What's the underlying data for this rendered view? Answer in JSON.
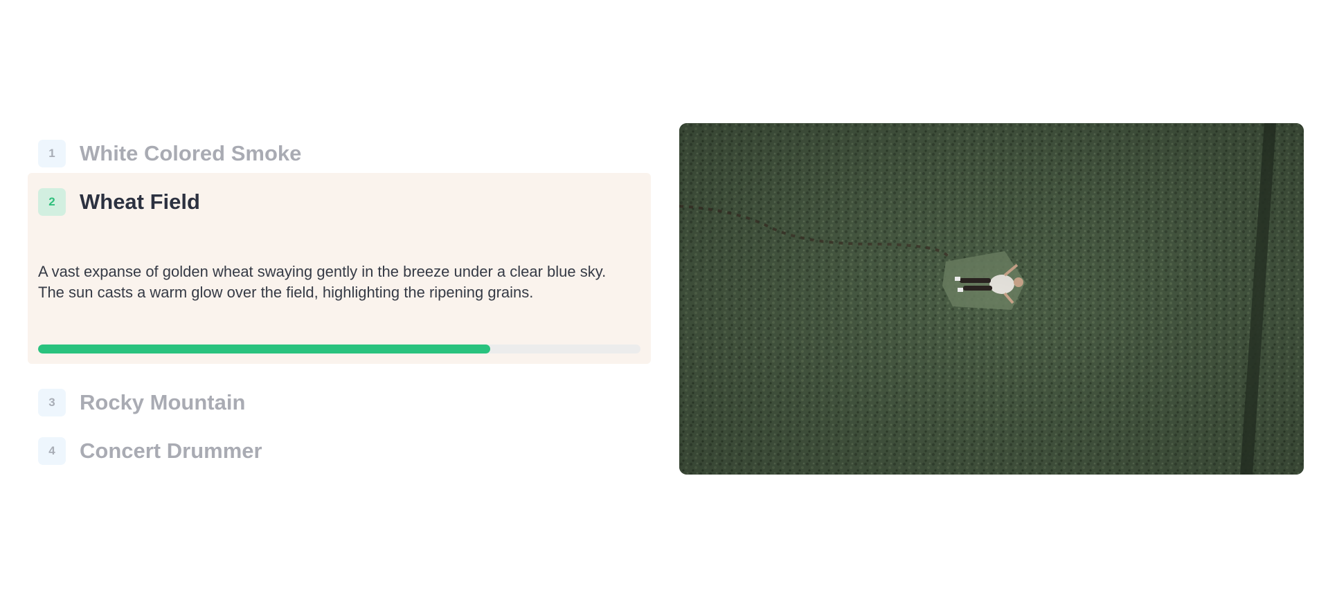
{
  "accordion": {
    "items": [
      {
        "number": "1",
        "title": "White Colored Smoke"
      },
      {
        "number": "2",
        "title": "Wheat Field",
        "description": "A vast expanse of golden wheat swaying gently in the breeze under a clear blue sky. The sun casts a warm glow over the field, highlighting the ripening grains.",
        "progress": 0.75
      },
      {
        "number": "3",
        "title": "Rocky Mountain"
      },
      {
        "number": "4",
        "title": "Concert Drummer"
      }
    ],
    "active_index": 1
  },
  "colors": {
    "accent": "#29c27e",
    "active_card_bg": "#faf3ed",
    "inactive_text": "#a9abb3",
    "active_text": "#2c3140"
  },
  "media": {
    "image_subject": "aerial view of person lying in green wheat field"
  }
}
